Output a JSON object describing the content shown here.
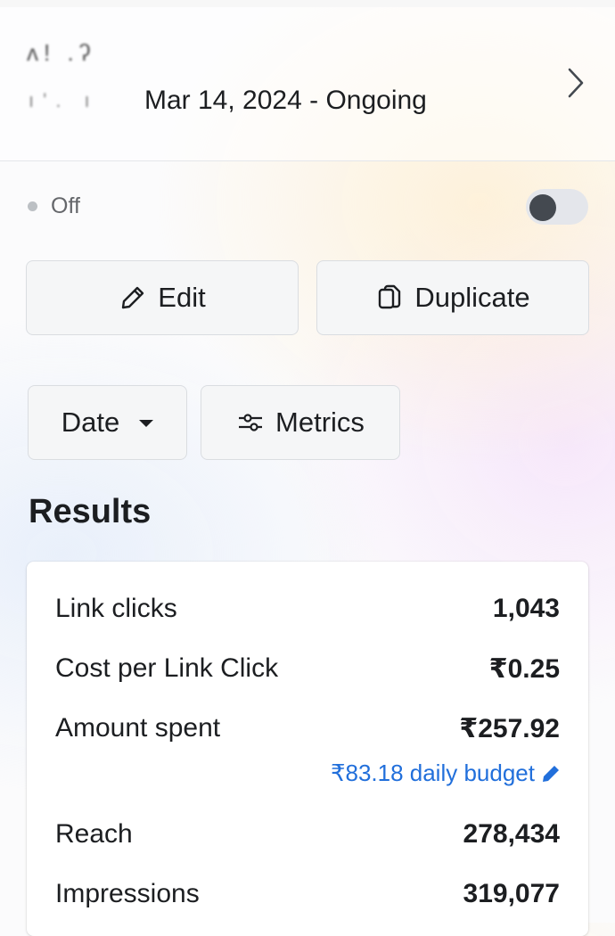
{
  "header": {
    "name_blurred": "ʌ! .ʔ",
    "name_blurred_line2": "ı'.  ı",
    "date_range": "Mar 14, 2024 -  Ongoing"
  },
  "status": {
    "label": "Off",
    "toggle_on": false
  },
  "actions": {
    "edit_label": "Edit",
    "duplicate_label": "Duplicate"
  },
  "filters": {
    "date_label": "Date",
    "metrics_label": "Metrics"
  },
  "results": {
    "title": "Results",
    "rows": [
      {
        "label": "Link clicks",
        "value": "1,043"
      },
      {
        "label": "Cost per Link Click",
        "value": "₹0.25"
      },
      {
        "label": "Amount spent",
        "value": "₹257.92"
      },
      {
        "label": "Reach",
        "value": "278,434"
      },
      {
        "label": "Impressions",
        "value": "319,077"
      }
    ],
    "budget_text": "₹83.18 daily budget"
  },
  "colors": {
    "accent_link": "#216fdb",
    "toggle_knob": "#444950",
    "status_dot": "#bcc0c4"
  },
  "icons": [
    "chevron-right-icon",
    "pencil-icon",
    "duplicate-icon",
    "caret-down-icon",
    "sliders-icon",
    "pencil-small-icon"
  ]
}
